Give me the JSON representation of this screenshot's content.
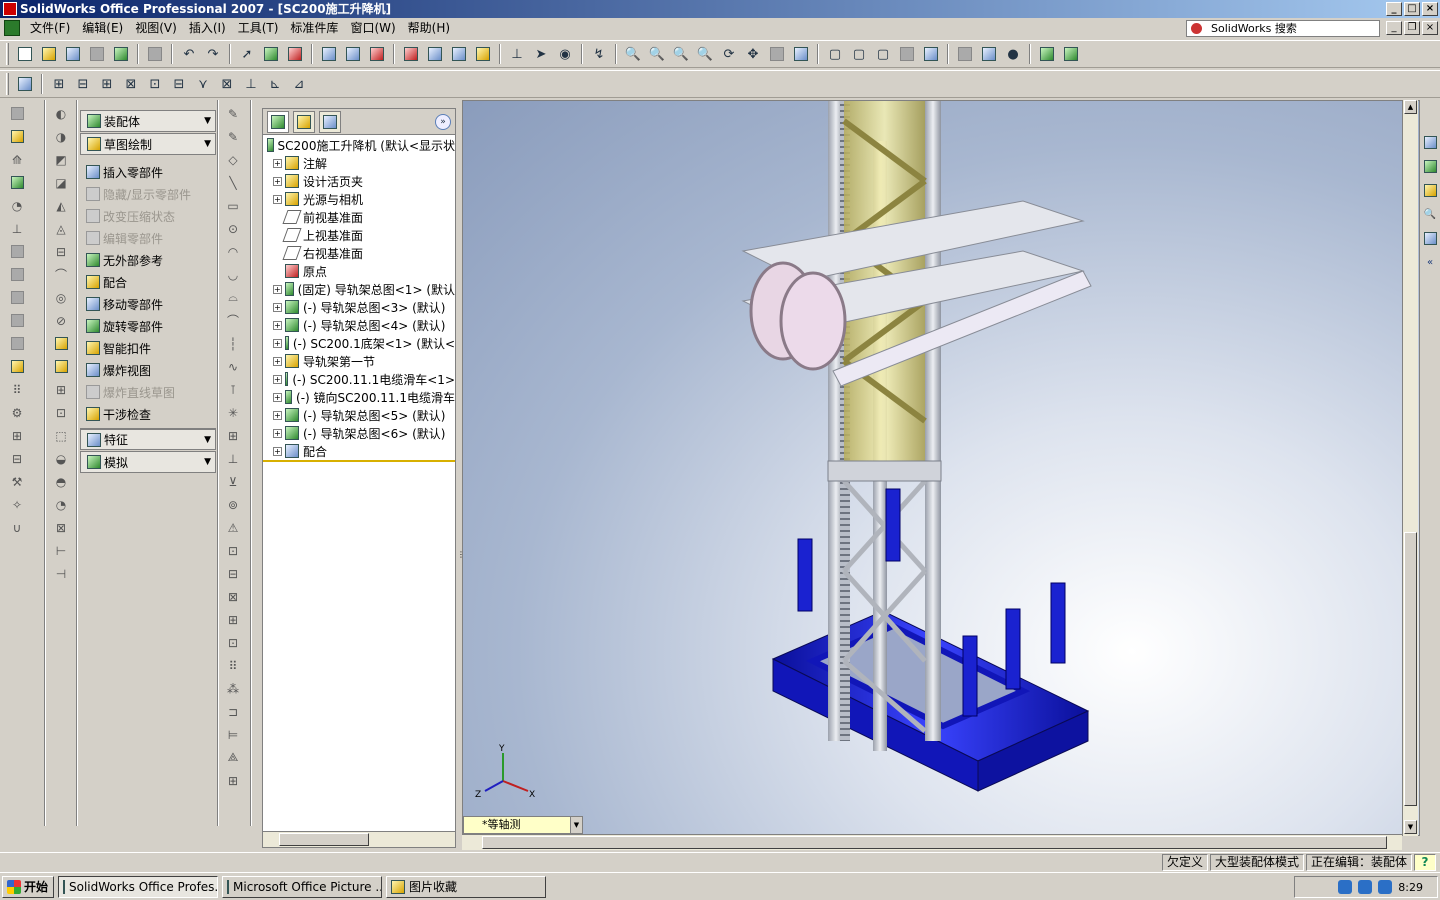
{
  "window": {
    "title": "SolidWorks Office Professional 2007 - [SC200施工升降机]",
    "min": "_",
    "max": "□",
    "close": "×",
    "restore": "❐"
  },
  "menu": [
    "文件(F)",
    "编辑(E)",
    "视图(V)",
    "插入(I)",
    "工具(T)",
    "标准件库",
    "窗口(W)",
    "帮助(H)"
  ],
  "search": {
    "label": "SolidWorks 搜索"
  },
  "command_manager": {
    "items": [
      {
        "label": "装配体",
        "header": true
      },
      {
        "label": "草图绘制",
        "header": true
      },
      {
        "label": "插入零部件",
        "enabled": true
      },
      {
        "label": "隐藏/显示零部件",
        "enabled": false
      },
      {
        "label": "改变压缩状态",
        "enabled": false
      },
      {
        "label": "编辑零部件",
        "enabled": false
      },
      {
        "label": "无外部参考",
        "enabled": true
      },
      {
        "label": "配合",
        "enabled": true
      },
      {
        "label": "移动零部件",
        "enabled": true
      },
      {
        "label": "旋转零部件",
        "enabled": true
      },
      {
        "label": "智能扣件",
        "enabled": true
      },
      {
        "label": "爆炸视图",
        "enabled": true
      },
      {
        "label": "爆炸直线草图",
        "enabled": false
      },
      {
        "label": "干涉检查",
        "enabled": true
      },
      {
        "label": "特征",
        "header": true
      },
      {
        "label": "模拟",
        "header": true
      }
    ]
  },
  "feature_tree": {
    "expand_label": "»",
    "root": "SC200施工升降机 (默认<显示状",
    "items": [
      {
        "label": "注解",
        "expand": true
      },
      {
        "label": "设计活页夹",
        "expand": true
      },
      {
        "label": "光源与相机",
        "expand": true
      },
      {
        "label": "前视基准面",
        "expand": false
      },
      {
        "label": "上视基准面",
        "expand": false
      },
      {
        "label": "右视基准面",
        "expand": false
      },
      {
        "label": "原点",
        "expand": false
      },
      {
        "label": "(固定) 导轨架总图<1> (默认",
        "expand": true
      },
      {
        "label": "(-) 导轨架总图<3> (默认)",
        "expand": true
      },
      {
        "label": "(-) 导轨架总图<4> (默认)",
        "expand": true
      },
      {
        "label": "(-) SC200.1底架<1> (默认<",
        "expand": true
      },
      {
        "label": "导轨架第一节",
        "expand": true
      },
      {
        "label": "(-) SC200.11.1电缆滑车<1>",
        "expand": true
      },
      {
        "label": "(-) 镜向SC200.11.1电缆滑车",
        "expand": true
      },
      {
        "label": "(-) 导轨架总图<5> (默认)",
        "expand": true
      },
      {
        "label": "(-) 导轨架总图<6> (默认)",
        "expand": true
      },
      {
        "label": "配合",
        "expand": true
      }
    ]
  },
  "viewport": {
    "view_orientation": "*等轴测",
    "axes": {
      "x": "X",
      "y": "Y",
      "z": "Z"
    }
  },
  "statusbar": [
    "欠定义",
    "大型装配体模式",
    "正在编辑：装配体"
  ],
  "help_label": "?",
  "taskbar": {
    "start": "开始",
    "tasks": [
      {
        "label": "SolidWorks Office Profes...",
        "active": true
      },
      {
        "label": "Microsoft Office Picture ...",
        "active": false
      },
      {
        "label": "图片收藏",
        "active": false
      }
    ],
    "clock": "8:29"
  },
  "colors": {
    "base_blue": "#1a1fd8",
    "frame_yellow": "#e6e096",
    "mast_gray": "#c8ccd4",
    "title_blue": "#0a246a"
  }
}
